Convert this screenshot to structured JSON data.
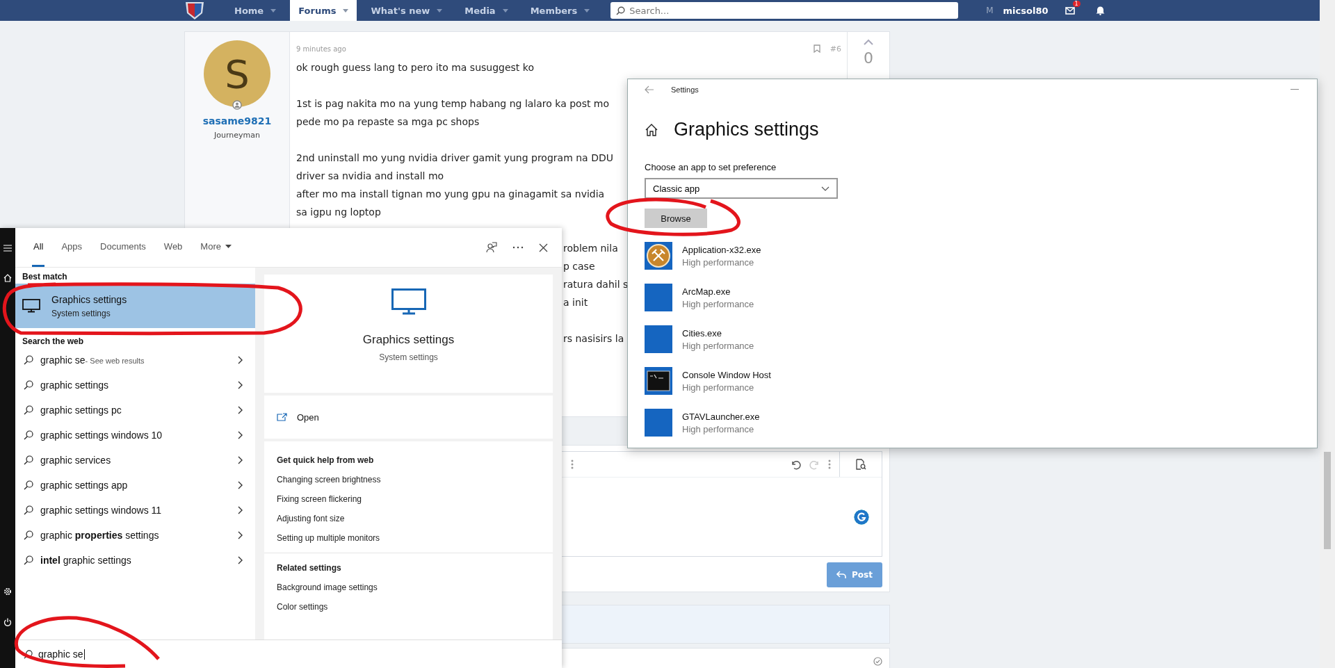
{
  "forum_nav": {
    "items": [
      {
        "label": "Home",
        "selected": false
      },
      {
        "label": "Forums",
        "selected": true
      },
      {
        "label": "What's new",
        "selected": false
      },
      {
        "label": "Media",
        "selected": false
      },
      {
        "label": "Members",
        "selected": false
      }
    ],
    "search": {
      "placeholder": "Search..."
    },
    "user_initial": "M",
    "username": "micsol80",
    "mail_badge": "1"
  },
  "post": {
    "avatar_letter": "S",
    "username": "sasame9821",
    "user_title": "Journeyman",
    "time": "9 minutes ago",
    "number": "#6",
    "votes": "0",
    "paragraphs": [
      {
        "kind": "full",
        "lines": [
          "ok rough guess lang to pero ito ma susuggest ko"
        ]
      },
      {
        "kind": "full",
        "lines": [
          "1st is pag nakita mo na yung temp habang ng lalaro ka post mo",
          "pede mo pa repaste sa mga pc shops"
        ]
      },
      {
        "kind": "full",
        "lines": [
          "2nd uninstall mo yung nvidia driver gamit yung program na DDU",
          "driver sa nvidia and install mo",
          "after mo ma install tignan mo yung gpu na ginagamit sa nvidia",
          "sa igpu ng loptop"
        ]
      },
      {
        "kind": "partial",
        "lines": [
          "roblem nila",
          "p case",
          "ratura dahil s",
          "a init"
        ]
      },
      {
        "kind": "partial",
        "lines": [
          "rs nasisirs la"
        ]
      }
    ]
  },
  "reply_editor": {
    "post_button": "Post"
  },
  "settings_window": {
    "title": "Settings",
    "heading": "Graphics settings",
    "label": "Choose an app to set preference",
    "dropdown": "Classic app",
    "browse_button": "Browse",
    "apps": [
      {
        "name": "Application-x32.exe",
        "mode": "High performance",
        "kind": "tools"
      },
      {
        "name": "ArcMap.exe",
        "mode": "High performance",
        "kind": "blank"
      },
      {
        "name": "Cities.exe",
        "mode": "High performance",
        "kind": "blank"
      },
      {
        "name": "Console Window Host",
        "mode": "High performance",
        "kind": "console"
      },
      {
        "name": "GTAVLauncher.exe",
        "mode": "High performance",
        "kind": "blank"
      }
    ]
  },
  "start_search": {
    "tabs": [
      {
        "label": "All",
        "selected": true
      },
      {
        "label": "Apps",
        "selected": false
      },
      {
        "label": "Documents",
        "selected": false
      },
      {
        "label": "Web",
        "selected": false
      },
      {
        "label": "More",
        "selected": false
      }
    ],
    "best_match_header": "Best match",
    "best_match": {
      "title": "Graphics settings",
      "subtitle": "System settings",
      "selected": true
    },
    "web_header": "Search the web",
    "suggestions": [
      {
        "text": "graphic se",
        "note": "- See web results"
      },
      {
        "text": "graphic settings"
      },
      {
        "text": "graphic settings pc"
      },
      {
        "text": "graphic settings windows 10"
      },
      {
        "text": "graphic services"
      },
      {
        "text": "graphic settings app"
      },
      {
        "text": "graphic settings windows 11"
      },
      {
        "text": "graphic **properties** settings"
      },
      {
        "text": "**intel** graphic settings"
      }
    ]
  },
  "preview": {
    "title": "Graphics settings",
    "subtitle": "System settings",
    "open": "Open",
    "quick_help_header": "Get quick help from web",
    "quick_help": [
      "Changing screen brightness",
      "Fixing screen flickering",
      "Adjusting font size",
      "Setting up multiple monitors"
    ],
    "related_header": "Related settings",
    "related": [
      "Background image settings",
      "Color settings"
    ]
  },
  "query": "graphic se"
}
